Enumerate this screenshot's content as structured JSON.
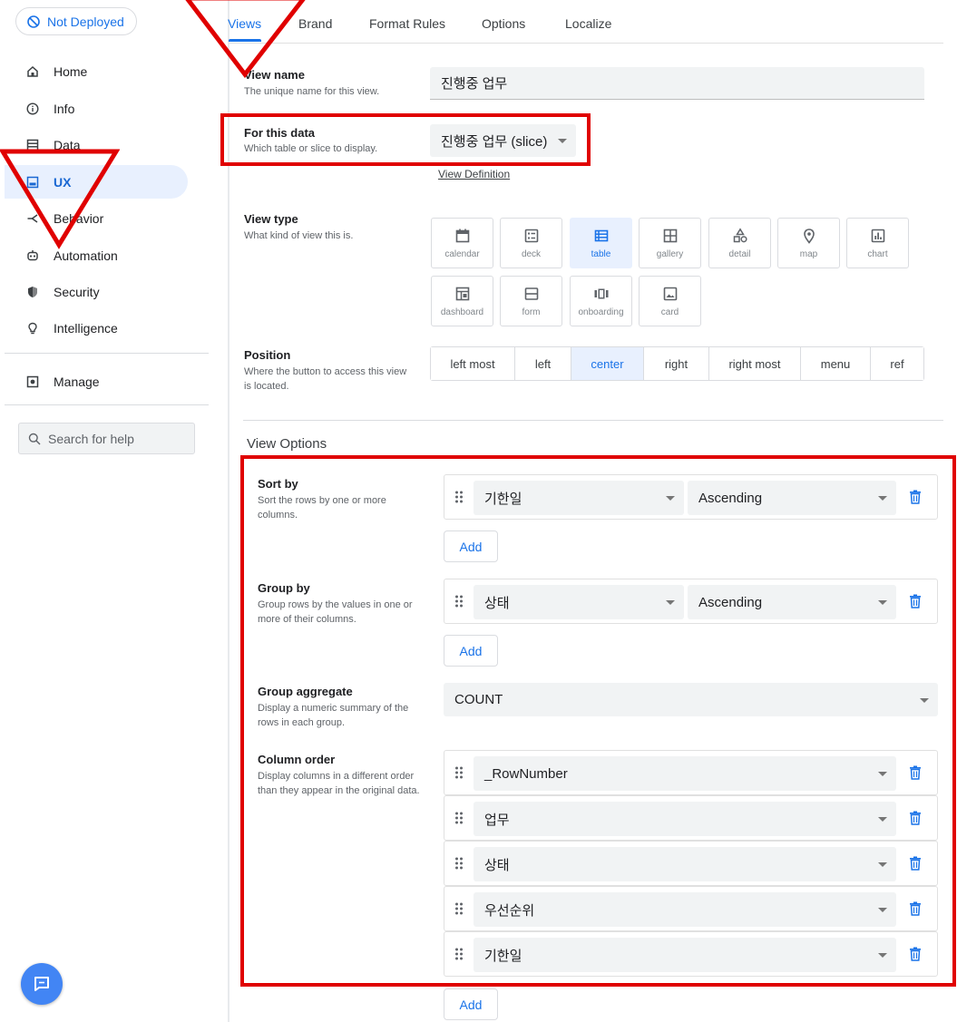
{
  "sidebar": {
    "deploy_status": "Not Deployed",
    "items": [
      {
        "label": "Home",
        "icon": "home-icon"
      },
      {
        "label": "Info",
        "icon": "info-icon"
      },
      {
        "label": "Data",
        "icon": "data-icon"
      },
      {
        "label": "UX",
        "icon": "ux-icon"
      },
      {
        "label": "Behavior",
        "icon": "behavior-icon"
      },
      {
        "label": "Automation",
        "icon": "automation-icon"
      },
      {
        "label": "Security",
        "icon": "security-icon"
      },
      {
        "label": "Intelligence",
        "icon": "intelligence-icon"
      },
      {
        "label": "Manage",
        "icon": "manage-icon"
      }
    ],
    "active_item": "UX",
    "search_placeholder": "Search for help"
  },
  "tabs": [
    {
      "label": "Views",
      "active": true
    },
    {
      "label": "Brand",
      "active": false
    },
    {
      "label": "Format Rules",
      "active": false
    },
    {
      "label": "Options",
      "active": false
    },
    {
      "label": "Localize",
      "active": false
    }
  ],
  "view_name": {
    "label": "View name",
    "help": "The unique name for this view.",
    "value": "진행중 업무"
  },
  "for_this_data": {
    "label": "For this data",
    "help": "Which table or slice to display.",
    "value": "진행중 업무 (slice)",
    "link": "View Definition"
  },
  "view_type": {
    "label": "View type",
    "help": "What kind of view this is.",
    "options": [
      "calendar",
      "deck",
      "table",
      "gallery",
      "detail",
      "map",
      "chart",
      "dashboard",
      "form",
      "onboarding",
      "card"
    ],
    "selected": "table"
  },
  "position": {
    "label": "Position",
    "help": "Where the button to access this view is located.",
    "options": [
      "left most",
      "left",
      "center",
      "right",
      "right most",
      "menu",
      "ref"
    ],
    "selected": "center"
  },
  "view_options": {
    "title": "View Options",
    "sort_by": {
      "label": "Sort by",
      "help": "Sort the rows by one or more columns.",
      "column": "기한일",
      "order": "Ascending",
      "add_label": "Add"
    },
    "group_by": {
      "label": "Group by",
      "help": "Group rows by the values in one or more of their columns.",
      "column": "상태",
      "order": "Ascending",
      "add_label": "Add"
    },
    "group_aggregate": {
      "label": "Group aggregate",
      "help": "Display a numeric summary of the rows in each group.",
      "value": "COUNT"
    },
    "column_order": {
      "label": "Column order",
      "help": "Display columns in a different order than they appear in the original data.",
      "columns": [
        "_RowNumber",
        "업무",
        "상태",
        "우선순위",
        "기한일"
      ],
      "add_label": "Add"
    }
  },
  "colors": {
    "accent": "#1a73e8",
    "annotation": "#e00000"
  }
}
